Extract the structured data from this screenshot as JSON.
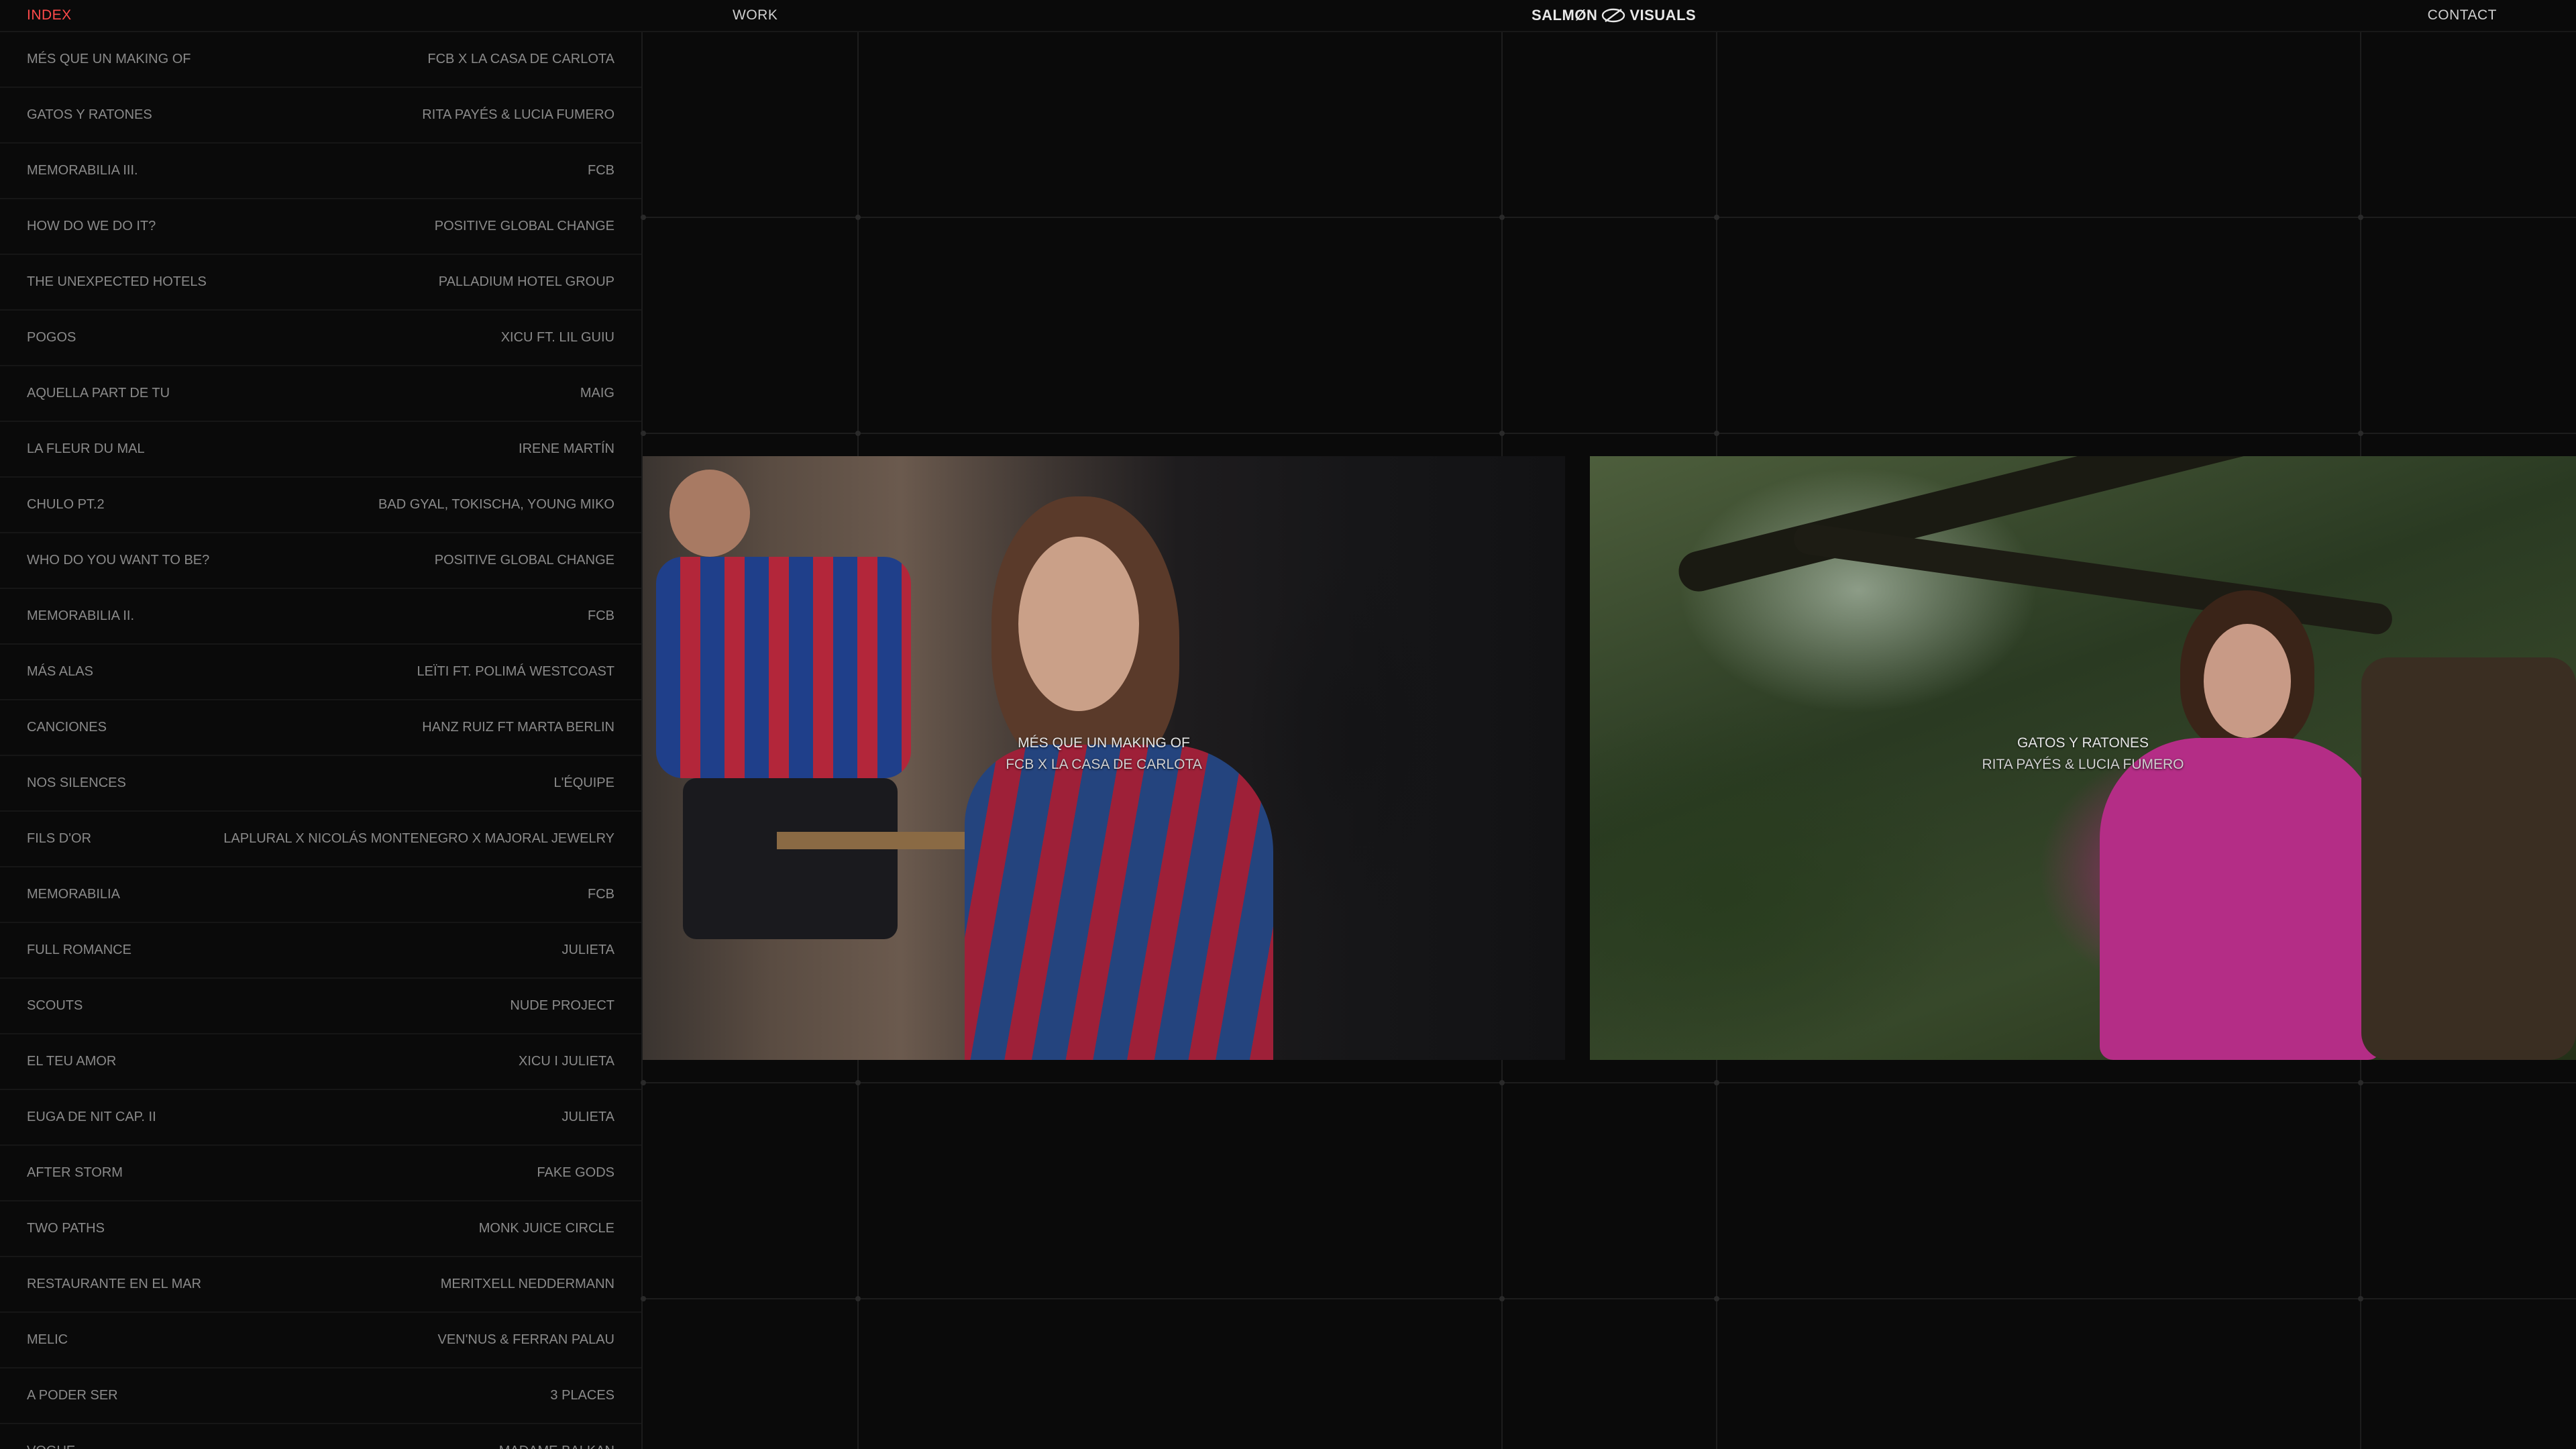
{
  "nav": {
    "index": "INDEX",
    "work": "WORK",
    "brand_left": "SALMØN",
    "brand_right": "VISUALS",
    "contact": "CONTACT"
  },
  "projects": [
    {
      "title": "MÉS QUE UN MAKING OF",
      "client": "FCB X LA CASA DE CARLOTA"
    },
    {
      "title": "GATOS Y RATONES",
      "client": "RITA PAYÉS & LUCIA FUMERO"
    },
    {
      "title": "MEMORABILIA III.",
      "client": "FCB"
    },
    {
      "title": "HOW DO WE DO IT?",
      "client": "POSITIVE GLOBAL CHANGE"
    },
    {
      "title": "THE UNEXPECTED HOTELS",
      "client": "PALLADIUM HOTEL GROUP"
    },
    {
      "title": "POGOS",
      "client": "XICU FT. LIL GUIU"
    },
    {
      "title": "AQUELLA PART DE TU",
      "client": "MAIG"
    },
    {
      "title": "LA FLEUR DU MAL",
      "client": "IRENE MARTÍN"
    },
    {
      "title": "CHULO PT.2",
      "client": "BAD GYAL, TOKISCHA, YOUNG MIKO"
    },
    {
      "title": "WHO DO YOU WANT TO BE?",
      "client": "POSITIVE GLOBAL CHANGE"
    },
    {
      "title": "MEMORABILIA II.",
      "client": "FCB"
    },
    {
      "title": "MÁS ALAS",
      "client": "LEÏTI FT. POLIMÁ WESTCOAST"
    },
    {
      "title": "CANCIONES",
      "client": "HANZ RUIZ FT MARTA BERLIN"
    },
    {
      "title": "NOS SILENCES",
      "client": "L'ÉQUIPE"
    },
    {
      "title": "FILS D'OR",
      "client": "LAPLURAL X NICOLÁS MONTENEGRO X MAJORAL JEWELRY"
    },
    {
      "title": "MEMORABILIA",
      "client": "FCB"
    },
    {
      "title": "FULL ROMANCE",
      "client": "JULIETA"
    },
    {
      "title": "SCOUTS",
      "client": "NUDE PROJECT"
    },
    {
      "title": "EL TEU AMOR",
      "client": "XICU I JULIETA"
    },
    {
      "title": "EUGA DE NIT CAP. II",
      "client": "JULIETA"
    },
    {
      "title": "AFTER STORM",
      "client": "FAKE GODS"
    },
    {
      "title": "TWO PATHS",
      "client": "MONK JUICE CIRCLE"
    },
    {
      "title": "RESTAURANTE EN EL MAR",
      "client": "MERITXELL NEDDERMANN"
    },
    {
      "title": "MELIC",
      "client": "VEN'NUS & FERRAN PALAU"
    },
    {
      "title": "A PODER SER",
      "client": "3 PLACES"
    },
    {
      "title": "VOGUE",
      "client": "MADAME BALKAN"
    }
  ],
  "cards": [
    {
      "title": "MÉS QUE UN MAKING OF",
      "client": "FCB X LA CASA DE CARLOTA"
    },
    {
      "title": "GATOS Y RATONES",
      "client": "RITA PAYÉS & LUCIA FUMERO"
    }
  ],
  "colors": {
    "accent": "#ff4a4a",
    "background": "#0a0a0a"
  }
}
